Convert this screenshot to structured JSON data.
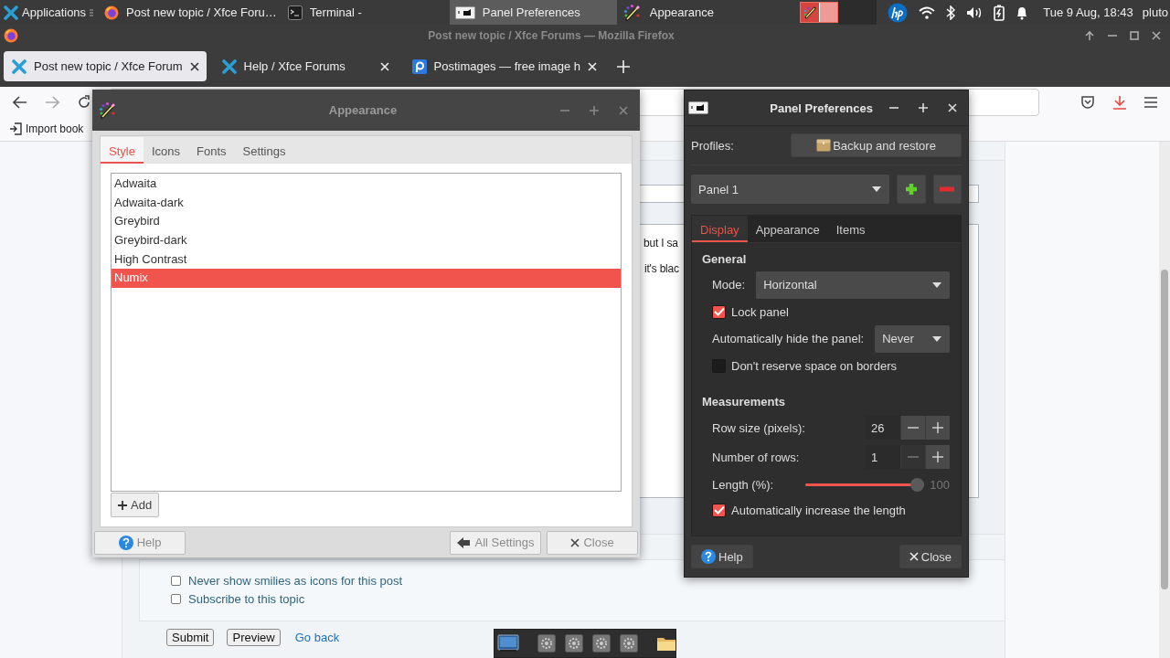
{
  "top_panel": {
    "tasks": [
      {
        "kind": "menu",
        "label": "Applications",
        "selected": false
      },
      {
        "kind": "browser",
        "label": "Post new topic / Xfce Foru…",
        "selected": false
      },
      {
        "kind": "terminal",
        "label": "Terminal -",
        "selected": false
      },
      {
        "kind": "panel",
        "label": "Panel Preferences",
        "selected": true
      },
      {
        "kind": "appearance",
        "label": "Appearance",
        "selected": false
      }
    ],
    "clock": "Tue  9 Aug, 18:43",
    "user": "pluto"
  },
  "browser": {
    "title": "Post new topic / Xfce Forums — Mozilla Firefox",
    "tabs": [
      {
        "kind": "xfce",
        "label": "Post new topic / Xfce Forum",
        "selected": true
      },
      {
        "kind": "xfce",
        "label": "Help / Xfce Forums",
        "selected": false
      },
      {
        "kind": "postimages",
        "label": "Postimages — free image h",
        "selected": false
      }
    ],
    "bookmarks": [
      "Import book"
    ],
    "page": {
      "message_lines": [
        "but I sa",
        "it's blac"
      ],
      "options": [
        {
          "label": "Never show smilies as icons for this post",
          "checked": false
        },
        {
          "label": "Subscribe to this topic",
          "checked": false
        }
      ],
      "buttons": [
        "Submit",
        "Preview"
      ],
      "link": "Go back"
    }
  },
  "appearance_window": {
    "title": "Appearance",
    "tabs": [
      {
        "label": "Style",
        "selected": true
      },
      {
        "label": "Icons",
        "selected": false
      },
      {
        "label": "Fonts",
        "selected": false
      },
      {
        "label": "Settings",
        "selected": false
      }
    ],
    "themes": [
      {
        "name": "Adwaita",
        "selected": false
      },
      {
        "name": "Adwaita-dark",
        "selected": false
      },
      {
        "name": "Greybird",
        "selected": false
      },
      {
        "name": "Greybird-dark",
        "selected": false
      },
      {
        "name": "High Contrast",
        "selected": false
      },
      {
        "name": "Numix",
        "selected": true
      }
    ],
    "add_button": "Add",
    "footer": {
      "help": "Help",
      "all_settings": "All Settings",
      "close": "Close"
    }
  },
  "panel_preferences": {
    "title": "Panel Preferences",
    "profiles_label": "Profiles:",
    "backup_button": "Backup and restore",
    "panel_select": "Panel 1",
    "tabs": [
      {
        "label": "Display",
        "selected": true
      },
      {
        "label": "Appearance",
        "selected": false
      },
      {
        "label": "Items",
        "selected": false
      }
    ],
    "sections": [
      {
        "heading": "General",
        "rows": [
          {
            "kind": "select",
            "label": "Mode:",
            "value": "Horizontal"
          },
          {
            "kind": "check",
            "label": "Lock panel",
            "checked": true
          },
          {
            "kind": "select",
            "label": "Automatically hide the panel:",
            "value": "Never"
          },
          {
            "kind": "check",
            "label": "Don't reserve space on borders",
            "checked": false
          }
        ]
      },
      {
        "heading": "Measurements",
        "rows": [
          {
            "kind": "spin",
            "label": "Row size (pixels):",
            "value": "26",
            "decrement_disabled": false
          },
          {
            "kind": "spin",
            "label": "Number of rows:",
            "value": "1",
            "decrement_disabled": true
          },
          {
            "kind": "slider",
            "label": "Length (%):",
            "level": 1,
            "reading": "100"
          },
          {
            "kind": "check",
            "label": "Automatically increase the length",
            "checked": true
          }
        ]
      }
    ],
    "footer": {
      "help": "Help",
      "close": "Close"
    }
  }
}
